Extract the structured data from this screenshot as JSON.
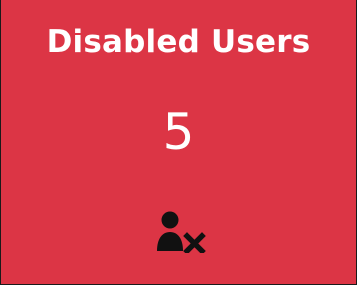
{
  "tile": {
    "title": "Disabled Users",
    "count": "5",
    "icon": "user-x-icon",
    "background_color": "#dc3545",
    "icon_color": "#111111"
  }
}
